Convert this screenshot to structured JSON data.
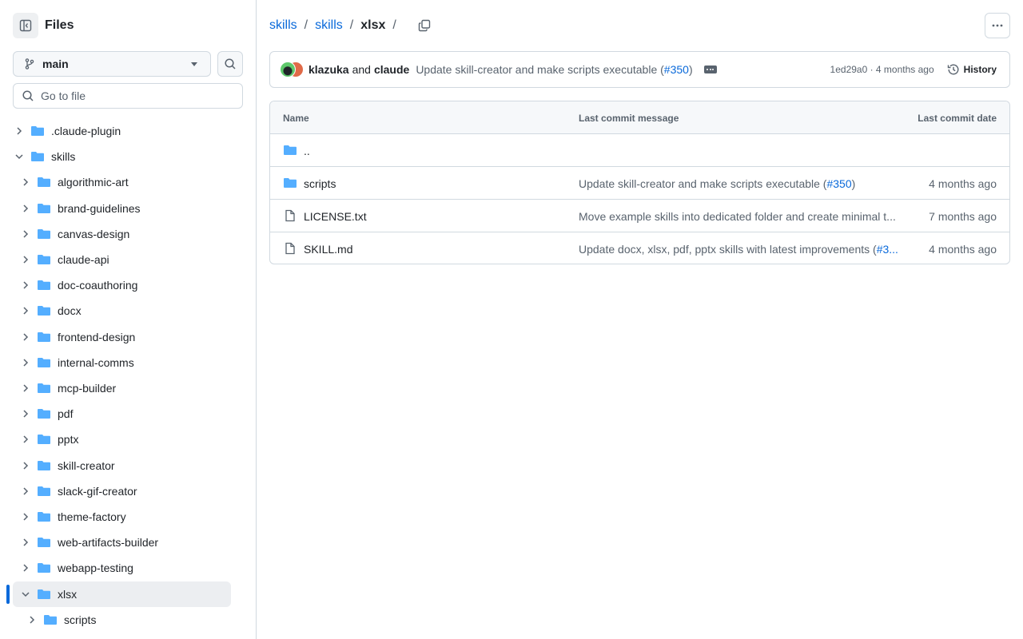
{
  "sidebar": {
    "title": "Files",
    "branch": "main",
    "goto_placeholder": "Go to file",
    "tree": [
      {
        "label": ".claude-plugin",
        "depth": 0,
        "expanded": false
      },
      {
        "label": "skills",
        "depth": 0,
        "expanded": true
      },
      {
        "label": "algorithmic-art",
        "depth": 1,
        "expanded": false
      },
      {
        "label": "brand-guidelines",
        "depth": 1,
        "expanded": false
      },
      {
        "label": "canvas-design",
        "depth": 1,
        "expanded": false
      },
      {
        "label": "claude-api",
        "depth": 1,
        "expanded": false
      },
      {
        "label": "doc-coauthoring",
        "depth": 1,
        "expanded": false
      },
      {
        "label": "docx",
        "depth": 1,
        "expanded": false
      },
      {
        "label": "frontend-design",
        "depth": 1,
        "expanded": false
      },
      {
        "label": "internal-comms",
        "depth": 1,
        "expanded": false
      },
      {
        "label": "mcp-builder",
        "depth": 1,
        "expanded": false
      },
      {
        "label": "pdf",
        "depth": 1,
        "expanded": false
      },
      {
        "label": "pptx",
        "depth": 1,
        "expanded": false
      },
      {
        "label": "skill-creator",
        "depth": 1,
        "expanded": false
      },
      {
        "label": "slack-gif-creator",
        "depth": 1,
        "expanded": false
      },
      {
        "label": "theme-factory",
        "depth": 1,
        "expanded": false
      },
      {
        "label": "web-artifacts-builder",
        "depth": 1,
        "expanded": false
      },
      {
        "label": "webapp-testing",
        "depth": 1,
        "expanded": false
      },
      {
        "label": "xlsx",
        "depth": 1,
        "expanded": true,
        "active": true
      },
      {
        "label": "scripts",
        "depth": 2,
        "expanded": false
      }
    ]
  },
  "breadcrumb": {
    "parts": [
      "skills",
      "skills"
    ],
    "current": "xlsx",
    "trailing": "/"
  },
  "commit": {
    "author1": "klazuka",
    "and": "and",
    "author2": "claude",
    "message": "Update skill-creator and make scripts executable (",
    "pr": "#350",
    "close": ")",
    "sha_time": "1ed29a0 · 4 months ago",
    "history_label": "History"
  },
  "table": {
    "headers": {
      "name": "Name",
      "message": "Last commit message",
      "date": "Last commit date"
    },
    "parent": "..",
    "rows": [
      {
        "type": "folder",
        "name": "scripts",
        "msg": "Update skill-creator and make scripts executable (",
        "pr": "#350",
        "msg_end": ")",
        "date": "4 months ago"
      },
      {
        "type": "file",
        "name": "LICENSE.txt",
        "msg": "Move example skills into dedicated folder and create minimal t...",
        "pr": "",
        "msg_end": "",
        "date": "7 months ago"
      },
      {
        "type": "file",
        "name": "SKILL.md",
        "msg": "Update docx, xlsx, pdf, pptx skills with latest improvements (",
        "pr": "#3...",
        "msg_end": "",
        "date": "4 months ago"
      }
    ]
  },
  "colors": {
    "accent": "#0969da",
    "folder": "#54aeff",
    "muted": "#59636e"
  }
}
